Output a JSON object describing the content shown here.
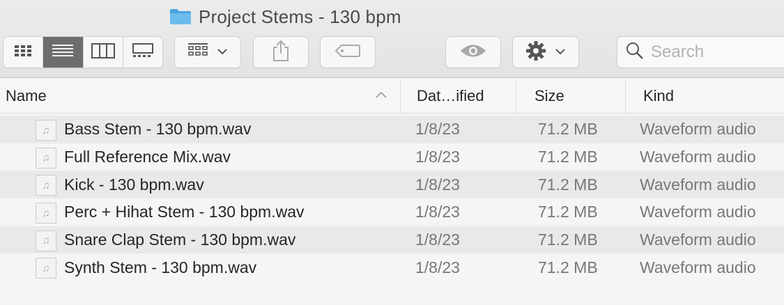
{
  "window": {
    "title": "Project Stems - 130 bpm",
    "title_icon": "folder-icon"
  },
  "toolbar": {
    "view_modes": [
      {
        "name": "icon-view",
        "icon": "grid-icon",
        "active": false
      },
      {
        "name": "list-view",
        "icon": "list-icon",
        "active": true
      },
      {
        "name": "column-view",
        "icon": "columns-icon",
        "active": false
      },
      {
        "name": "gallery-view",
        "icon": "gallery-icon",
        "active": false
      }
    ],
    "group_icon": "group-grid-icon",
    "share_icon": "share-icon",
    "tag_icon": "tag-icon",
    "quicklook_icon": "eye-icon",
    "action_icon": "gear-icon",
    "search_placeholder": "Search"
  },
  "columns": {
    "name": "Name",
    "date": "Dat…ified",
    "size": "Size",
    "kind": "Kind"
  },
  "files": [
    {
      "name": "Bass Stem - 130 bpm.wav",
      "date": "1/8/23",
      "size": "71.2 MB",
      "kind": "Waveform audio"
    },
    {
      "name": "Full Reference Mix.wav",
      "date": "1/8/23",
      "size": "71.2 MB",
      "kind": "Waveform audio"
    },
    {
      "name": "Kick - 130 bpm.wav",
      "date": "1/8/23",
      "size": "71.2 MB",
      "kind": "Waveform audio"
    },
    {
      "name": "Perc + Hihat Stem - 130 bpm.wav",
      "date": "1/8/23",
      "size": "71.2 MB",
      "kind": "Waveform audio"
    },
    {
      "name": "Snare Clap Stem - 130 bpm.wav",
      "date": "1/8/23",
      "size": "71.2 MB",
      "kind": "Waveform audio"
    },
    {
      "name": "Synth Stem - 130 bpm.wav",
      "date": "1/8/23",
      "size": "71.2 MB",
      "kind": "Waveform audio"
    }
  ],
  "colors": {
    "folder_blue": "#5fb2e6",
    "active_segment": "#6d6d6d",
    "row_alt": "#e9e9e9"
  }
}
